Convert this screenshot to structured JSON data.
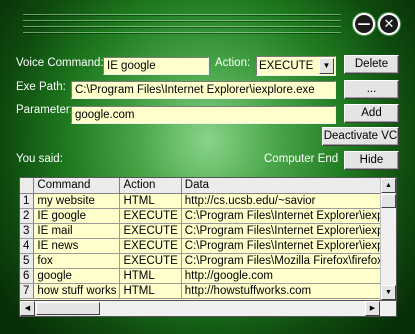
{
  "window": {
    "minimize_glyph": "—",
    "close_glyph": "✕"
  },
  "form": {
    "voice_command_label": "Voice Command:",
    "voice_command_value": "IE google",
    "action_label": "Action:",
    "action_value": "EXECUTE",
    "exe_path_label": "Exe Path:",
    "exe_path_value": "C:\\Program Files\\Internet Explorer\\iexplore.exe",
    "parameter_label": "Parameter:",
    "parameter_value": "google.com",
    "you_said_label": "You said:",
    "computer_end_label": "Computer End"
  },
  "buttons": {
    "delete": "Delete",
    "browse": "...",
    "add": "Add",
    "deactivate": "Deactivate VC",
    "hide": "Hide"
  },
  "table": {
    "columns": [
      "",
      "Command",
      "Action",
      "Data"
    ],
    "rows": [
      {
        "num": "1",
        "command": "my website",
        "action": "HTML",
        "data": "http://cs.ucsb.edu/~savior"
      },
      {
        "num": "2",
        "command": "IE google",
        "action": "EXECUTE",
        "data": "C:\\Program Files\\Internet Explorer\\iexplore.exe"
      },
      {
        "num": "3",
        "command": "IE mail",
        "action": "EXECUTE",
        "data": "C:\\Program Files\\Internet Explorer\\iexplore.exe"
      },
      {
        "num": "4",
        "command": "IE news",
        "action": "EXECUTE",
        "data": "C:\\Program Files\\Internet Explorer\\iexplore.exe"
      },
      {
        "num": "5",
        "command": "fox",
        "action": "EXECUTE",
        "data": "C:\\Program Files\\Mozilla Firefox\\firefox.exe"
      },
      {
        "num": "6",
        "command": "google",
        "action": "HTML",
        "data": "http://google.com"
      },
      {
        "num": "7",
        "command": "how stuff works",
        "action": "HTML",
        "data": "http://howstuffworks.com"
      }
    ]
  },
  "colors": {
    "background_center": "#8ad48a",
    "background_edge": "#082e08",
    "field_background": "#ffffcc"
  },
  "icons": {
    "minimize": "minimize-icon",
    "close": "close-icon",
    "dropdown": "chevron-down-icon",
    "scroll_up": "arrow-up-icon",
    "scroll_down": "arrow-down-icon",
    "scroll_left": "arrow-left-icon",
    "scroll_right": "arrow-right-icon"
  }
}
